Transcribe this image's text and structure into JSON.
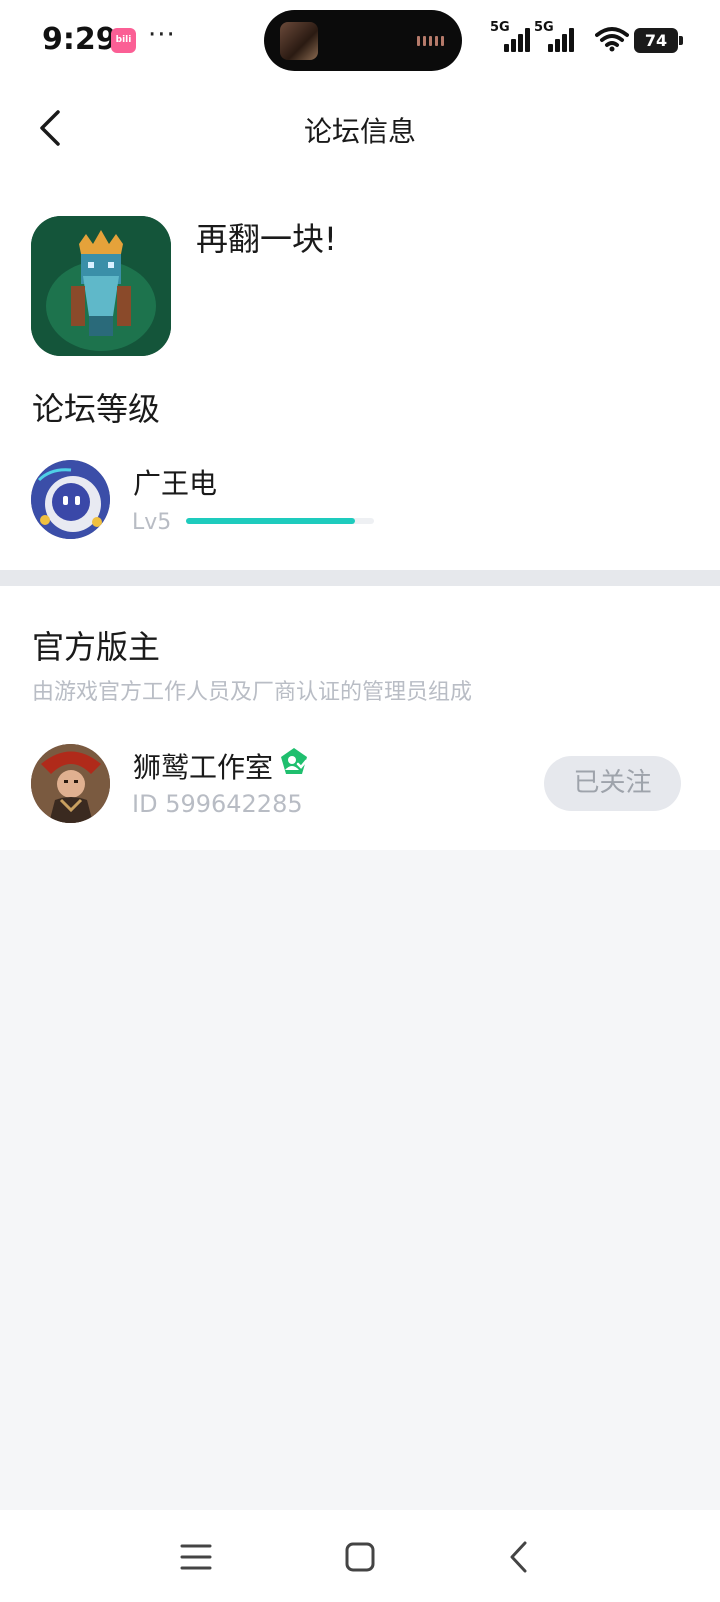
{
  "status_bar": {
    "time": "9:29",
    "app_badge": "bili",
    "dots": "···",
    "signal_1_label": "5G",
    "signal_2_label": "5G",
    "battery": "74"
  },
  "header": {
    "title": "论坛信息",
    "back_icon": "chevron-left-icon"
  },
  "forum": {
    "game_name": "再翻一块!",
    "level_section_title": "论坛等级",
    "user": {
      "name": "广王电",
      "level": "Lv5",
      "progress": 0.9
    }
  },
  "moderators": {
    "title": "官方版主",
    "subtitle": "由游戏官方工作人员及厂商认证的管理员组成",
    "items": [
      {
        "name": "狮鹫工作室",
        "id_text": "ID 599642285",
        "follow_label": "已关注"
      }
    ]
  },
  "colors": {
    "accent": "#1ecbbd",
    "verified": "#1fbf6e",
    "divider": "#e6e8ec",
    "page_bg": "#f5f6f8"
  },
  "nav": {
    "menu_icon": "menu-icon",
    "home_icon": "home-icon",
    "back_icon": "back-icon"
  }
}
